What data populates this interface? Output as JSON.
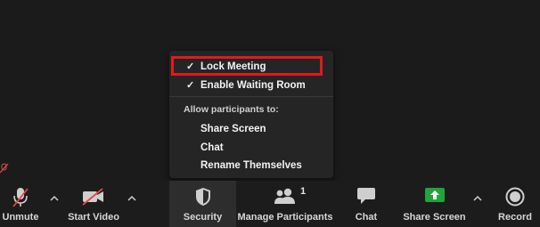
{
  "menu": {
    "items": [
      {
        "label": "Lock Meeting",
        "checked": true
      },
      {
        "label": "Enable Waiting Room",
        "checked": true
      }
    ],
    "check_glyph": "✓",
    "section_label": "Allow participants to:",
    "sub_items": [
      "Share Screen",
      "Chat",
      "Rename Themselves"
    ],
    "highlight_color": "#e3181f"
  },
  "toolbar": {
    "unmute_label": "Unmute",
    "start_video_label": "Start Video",
    "security_label": "Security",
    "participants_label": "Manage Participants",
    "participants_count": "1",
    "chat_label": "Chat",
    "share_label": "Share Screen",
    "record_label": "Record",
    "share_accent": "#22a33b"
  },
  "icons": {
    "mic": "mic-muted-icon",
    "video": "video-off-icon",
    "security": "shield-icon",
    "participants": "people-icon",
    "chat": "chat-bubble-icon",
    "share": "share-up-arrow-icon",
    "record": "record-icon"
  }
}
